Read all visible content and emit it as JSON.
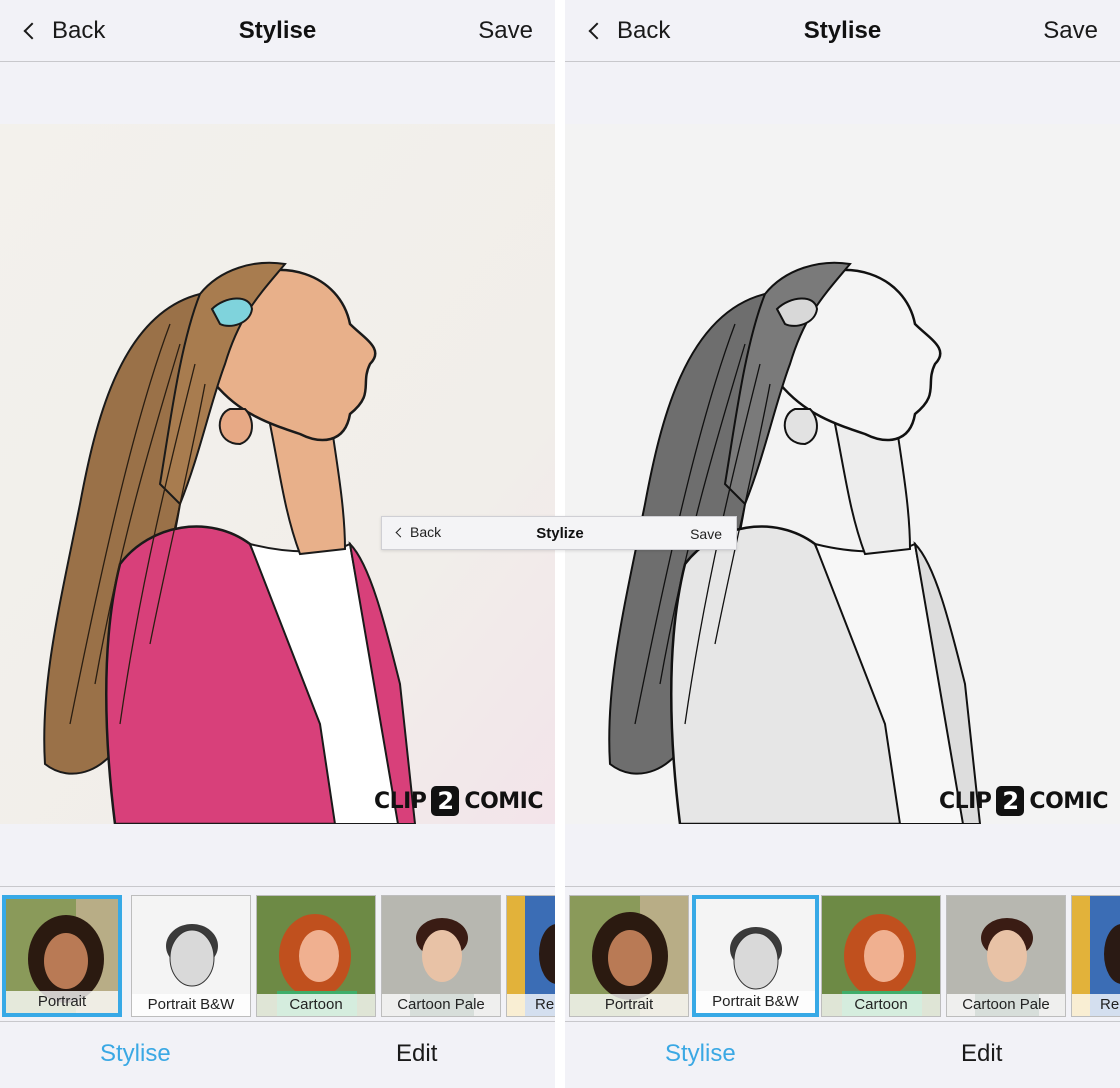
{
  "left_screen": {
    "navbar": {
      "back_label": "Back",
      "title": "Stylise",
      "save_label": "Save"
    },
    "watermark": {
      "text_left": "CLIP",
      "text_mid": "2",
      "text_right": "COMIC"
    },
    "styles": [
      {
        "label": "Portrait",
        "selected": true
      },
      {
        "label": "Portrait B&W",
        "selected": false
      },
      {
        "label": "Cartoon",
        "selected": false
      },
      {
        "label": "Cartoon Pale",
        "selected": false
      },
      {
        "label": "Re",
        "selected": false
      }
    ],
    "tabs": {
      "stylise": "Stylise",
      "edit": "Edit"
    }
  },
  "right_screen": {
    "navbar": {
      "back_label": "Back",
      "title": "Stylise",
      "save_label": "Save"
    },
    "watermark": {
      "text_left": "CLIP",
      "text_mid": "2",
      "text_right": "COMIC"
    },
    "styles": [
      {
        "label": "Portrait",
        "selected": false
      },
      {
        "label": "Portrait B&W",
        "selected": true
      },
      {
        "label": "Cartoon",
        "selected": false
      },
      {
        "label": "Cartoon Pale",
        "selected": false
      },
      {
        "label": "Re",
        "selected": false
      }
    ],
    "tabs": {
      "stylise": "Stylise",
      "edit": "Edit"
    }
  },
  "inset_navbar": {
    "back_label": "Back",
    "title": "Stylize",
    "save_label": "Save"
  },
  "colors": {
    "accent": "#37a9e6",
    "active_tab": "#3aa8e4",
    "cardigan_pink": "#d8407a",
    "hair_brown": "#9a7148",
    "skin": "#e8b08a",
    "hair_clip": "#7fd3dc"
  },
  "icons": {
    "back": "chevron-left-icon",
    "logo": "clip2comic-logo"
  }
}
